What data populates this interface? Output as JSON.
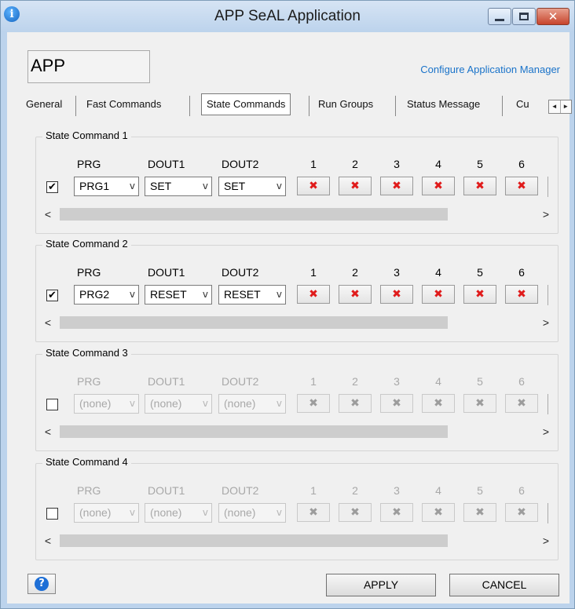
{
  "window": {
    "title": "APP SeAL Application",
    "icon": "info-icon",
    "controls": [
      "minimize-icon",
      "maximize-icon",
      "close-icon"
    ]
  },
  "app_name": "APP",
  "config_link": "Configure Application Manager",
  "tabs": [
    {
      "label": "General",
      "selected": false
    },
    {
      "label": "Fast Commands",
      "selected": false
    },
    {
      "label": "State Commands",
      "selected": true
    },
    {
      "label": "Run Groups",
      "selected": false
    },
    {
      "label": "Status Message",
      "selected": false
    },
    {
      "label": "Cu",
      "selected": false
    }
  ],
  "tab_scroll": {
    "left": "◄",
    "right": "►"
  },
  "columns": {
    "prg": "PRG",
    "dout1": "DOUT1",
    "dout2": "DOUT2",
    "numbers": [
      "1",
      "2",
      "3",
      "4",
      "5",
      "6"
    ]
  },
  "state_commands": [
    {
      "title": "State Command 1",
      "enabled": true,
      "checked": true,
      "prg": "PRG1",
      "dout1": "SET",
      "dout2": "SET",
      "mark": "✖"
    },
    {
      "title": "State Command 2",
      "enabled": true,
      "checked": true,
      "prg": "PRG2",
      "dout1": "RESET",
      "dout2": "RESET",
      "mark": "✖"
    },
    {
      "title": "State Command 3",
      "enabled": false,
      "checked": false,
      "prg": "(none)",
      "dout1": "(none)",
      "dout2": "(none)",
      "mark": "✖"
    },
    {
      "title": "State Command 4",
      "enabled": false,
      "checked": false,
      "prg": "(none)",
      "dout1": "(none)",
      "dout2": "(none)",
      "mark": "✖"
    }
  ],
  "checkmark": "✔",
  "combo_arrow": "v",
  "scroll": {
    "left": "<",
    "right": ">"
  },
  "footer": {
    "help_icon": "help-icon",
    "help_glyph": "?",
    "apply": "APPLY",
    "cancel": "CANCEL"
  },
  "colors": {
    "link": "#1a73c9",
    "x_mark_active": "#e01b1b",
    "title_bar": "#bcd3ec",
    "close_button": "#c7442c"
  }
}
